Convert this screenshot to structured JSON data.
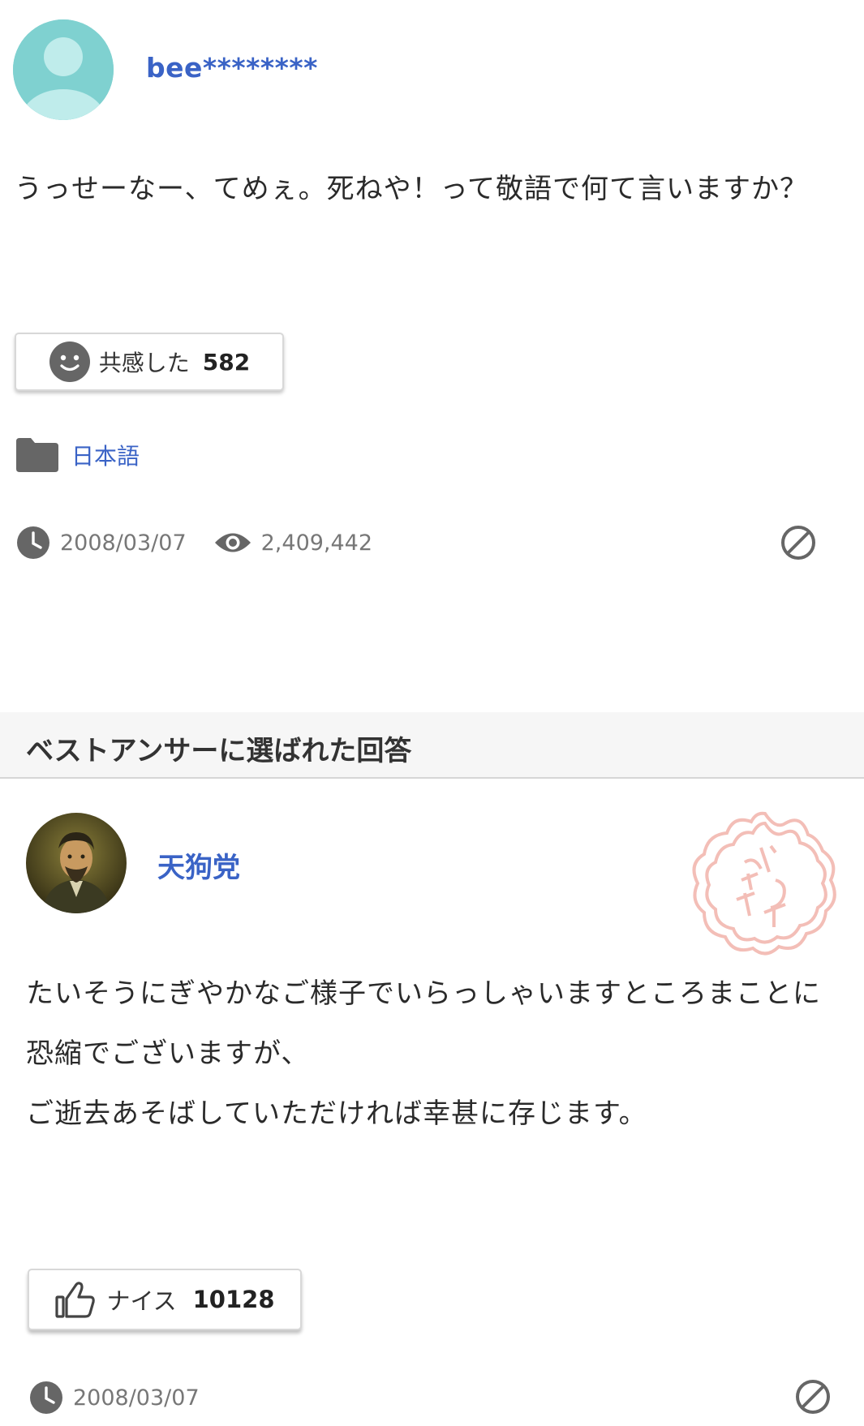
{
  "question": {
    "username": "bee********",
    "body": "うっせーなー、てめぇ。死ねや！って敬語で何て言いますか？",
    "empathy": {
      "label": "共感した",
      "count": "582"
    },
    "category": "日本語",
    "date": "2008/03/07",
    "views": "2,409,442"
  },
  "best_answer": {
    "header": "ベストアンサーに選ばれた回答",
    "username": "天狗党",
    "stamp_text": "ベストアンサー",
    "body_lines": [
      "たいそうにぎやかなご様子でいらっしゃいますところまことに",
      "恐縮でございますが、",
      "ご逝去あそばしていただければ幸甚に存じます。"
    ],
    "nice": {
      "label": "ナイス",
      "count": "10128"
    },
    "date": "2008/03/07"
  },
  "colors": {
    "link": "#3a63c6",
    "icon_gray": "#666666",
    "avatar_teal": "#7fd1d0",
    "stamp_pink": "#f2b8b0"
  },
  "icons": {
    "avatar_default": "default-user-avatar-icon",
    "empathy": "smiley-face-icon",
    "category": "folder-icon",
    "date": "clock-icon",
    "views": "eye-icon",
    "report": "prohibited-icon",
    "nice": "thumbs-up-icon"
  }
}
